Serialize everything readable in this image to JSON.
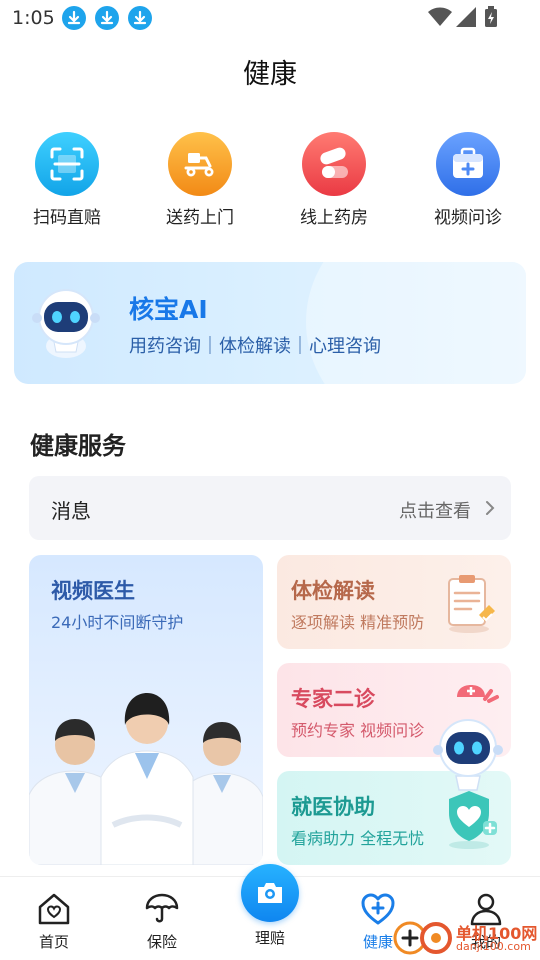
{
  "status_bar": {
    "time": "1:05"
  },
  "header": {
    "title": "健康"
  },
  "quick_actions": [
    {
      "label": "扫码直赔",
      "icon": "scan-icon",
      "color": "#1cb0ef"
    },
    {
      "label": "送药上门",
      "icon": "delivery-scooter-icon",
      "color": "#f59a25"
    },
    {
      "label": "线上药房",
      "icon": "pill-icon",
      "color": "#f04c50"
    },
    {
      "label": "视频问诊",
      "icon": "medical-kit-icon",
      "color": "#3d7cf0"
    }
  ],
  "ai_banner": {
    "title": "核宝AI",
    "tags": "用药咨询｜体检解读｜心理咨询"
  },
  "services": {
    "title": "健康服务",
    "message": {
      "label": "消息",
      "action": "点击查看"
    },
    "video_doctor": {
      "title": "视频医生",
      "subtitle": "24小时不间断守护"
    },
    "cards": [
      {
        "title": "体检解读",
        "subtitle": "逐项解读 精准预防"
      },
      {
        "title": "专家二诊",
        "subtitle": "预约专家 视频问诊"
      },
      {
        "title": "就医协助",
        "subtitle": "看病助力 全程无忧"
      }
    ]
  },
  "bottom_nav": {
    "items": [
      {
        "label": "首页"
      },
      {
        "label": "保险"
      },
      {
        "label": "理赔"
      },
      {
        "label": "健康",
        "active": true
      },
      {
        "label": "我的"
      }
    ]
  },
  "watermark": {
    "text": "单机100网",
    "url": "danji100.com"
  },
  "colors": {
    "accent": "#1a7ee8",
    "ai_title": "#1878e8"
  }
}
